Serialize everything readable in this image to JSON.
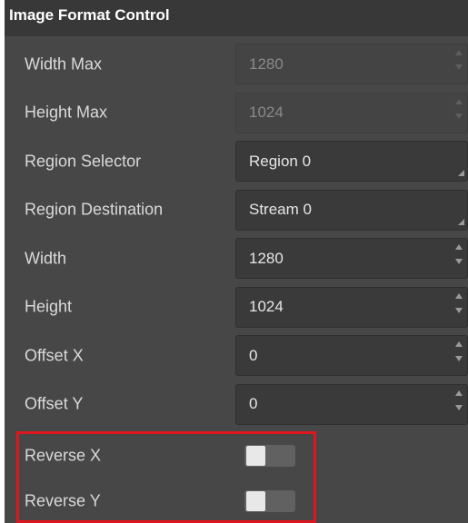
{
  "panel": {
    "title": "Image Format Control",
    "rows": [
      {
        "label": "Width Max",
        "value": "1280",
        "control": "spin",
        "disabled": true
      },
      {
        "label": "Height Max",
        "value": "1024",
        "control": "spin",
        "disabled": true
      },
      {
        "label": "Region Selector",
        "value": "Region 0",
        "control": "dropdown",
        "disabled": false
      },
      {
        "label": "Region Destination",
        "value": "Stream 0",
        "control": "dropdown",
        "disabled": false
      },
      {
        "label": "Width",
        "value": "1280",
        "control": "spin",
        "disabled": false
      },
      {
        "label": "Height",
        "value": "1024",
        "control": "spin",
        "disabled": false
      },
      {
        "label": "Offset X",
        "value": "0",
        "control": "spin",
        "disabled": false
      },
      {
        "label": "Offset Y",
        "value": "0",
        "control": "spin",
        "disabled": false
      },
      {
        "label": "Reverse X",
        "control": "toggle",
        "on": false
      },
      {
        "label": "Reverse Y",
        "control": "toggle",
        "on": false
      }
    ]
  },
  "icons": {
    "spin_up": "triangle-up-icon",
    "spin_down": "triangle-down-icon",
    "dropdown": "dropdown-corner-icon"
  },
  "colors": {
    "panel_bg": "#474747",
    "title_bg": "#383838",
    "highlight": "#e0161e"
  }
}
